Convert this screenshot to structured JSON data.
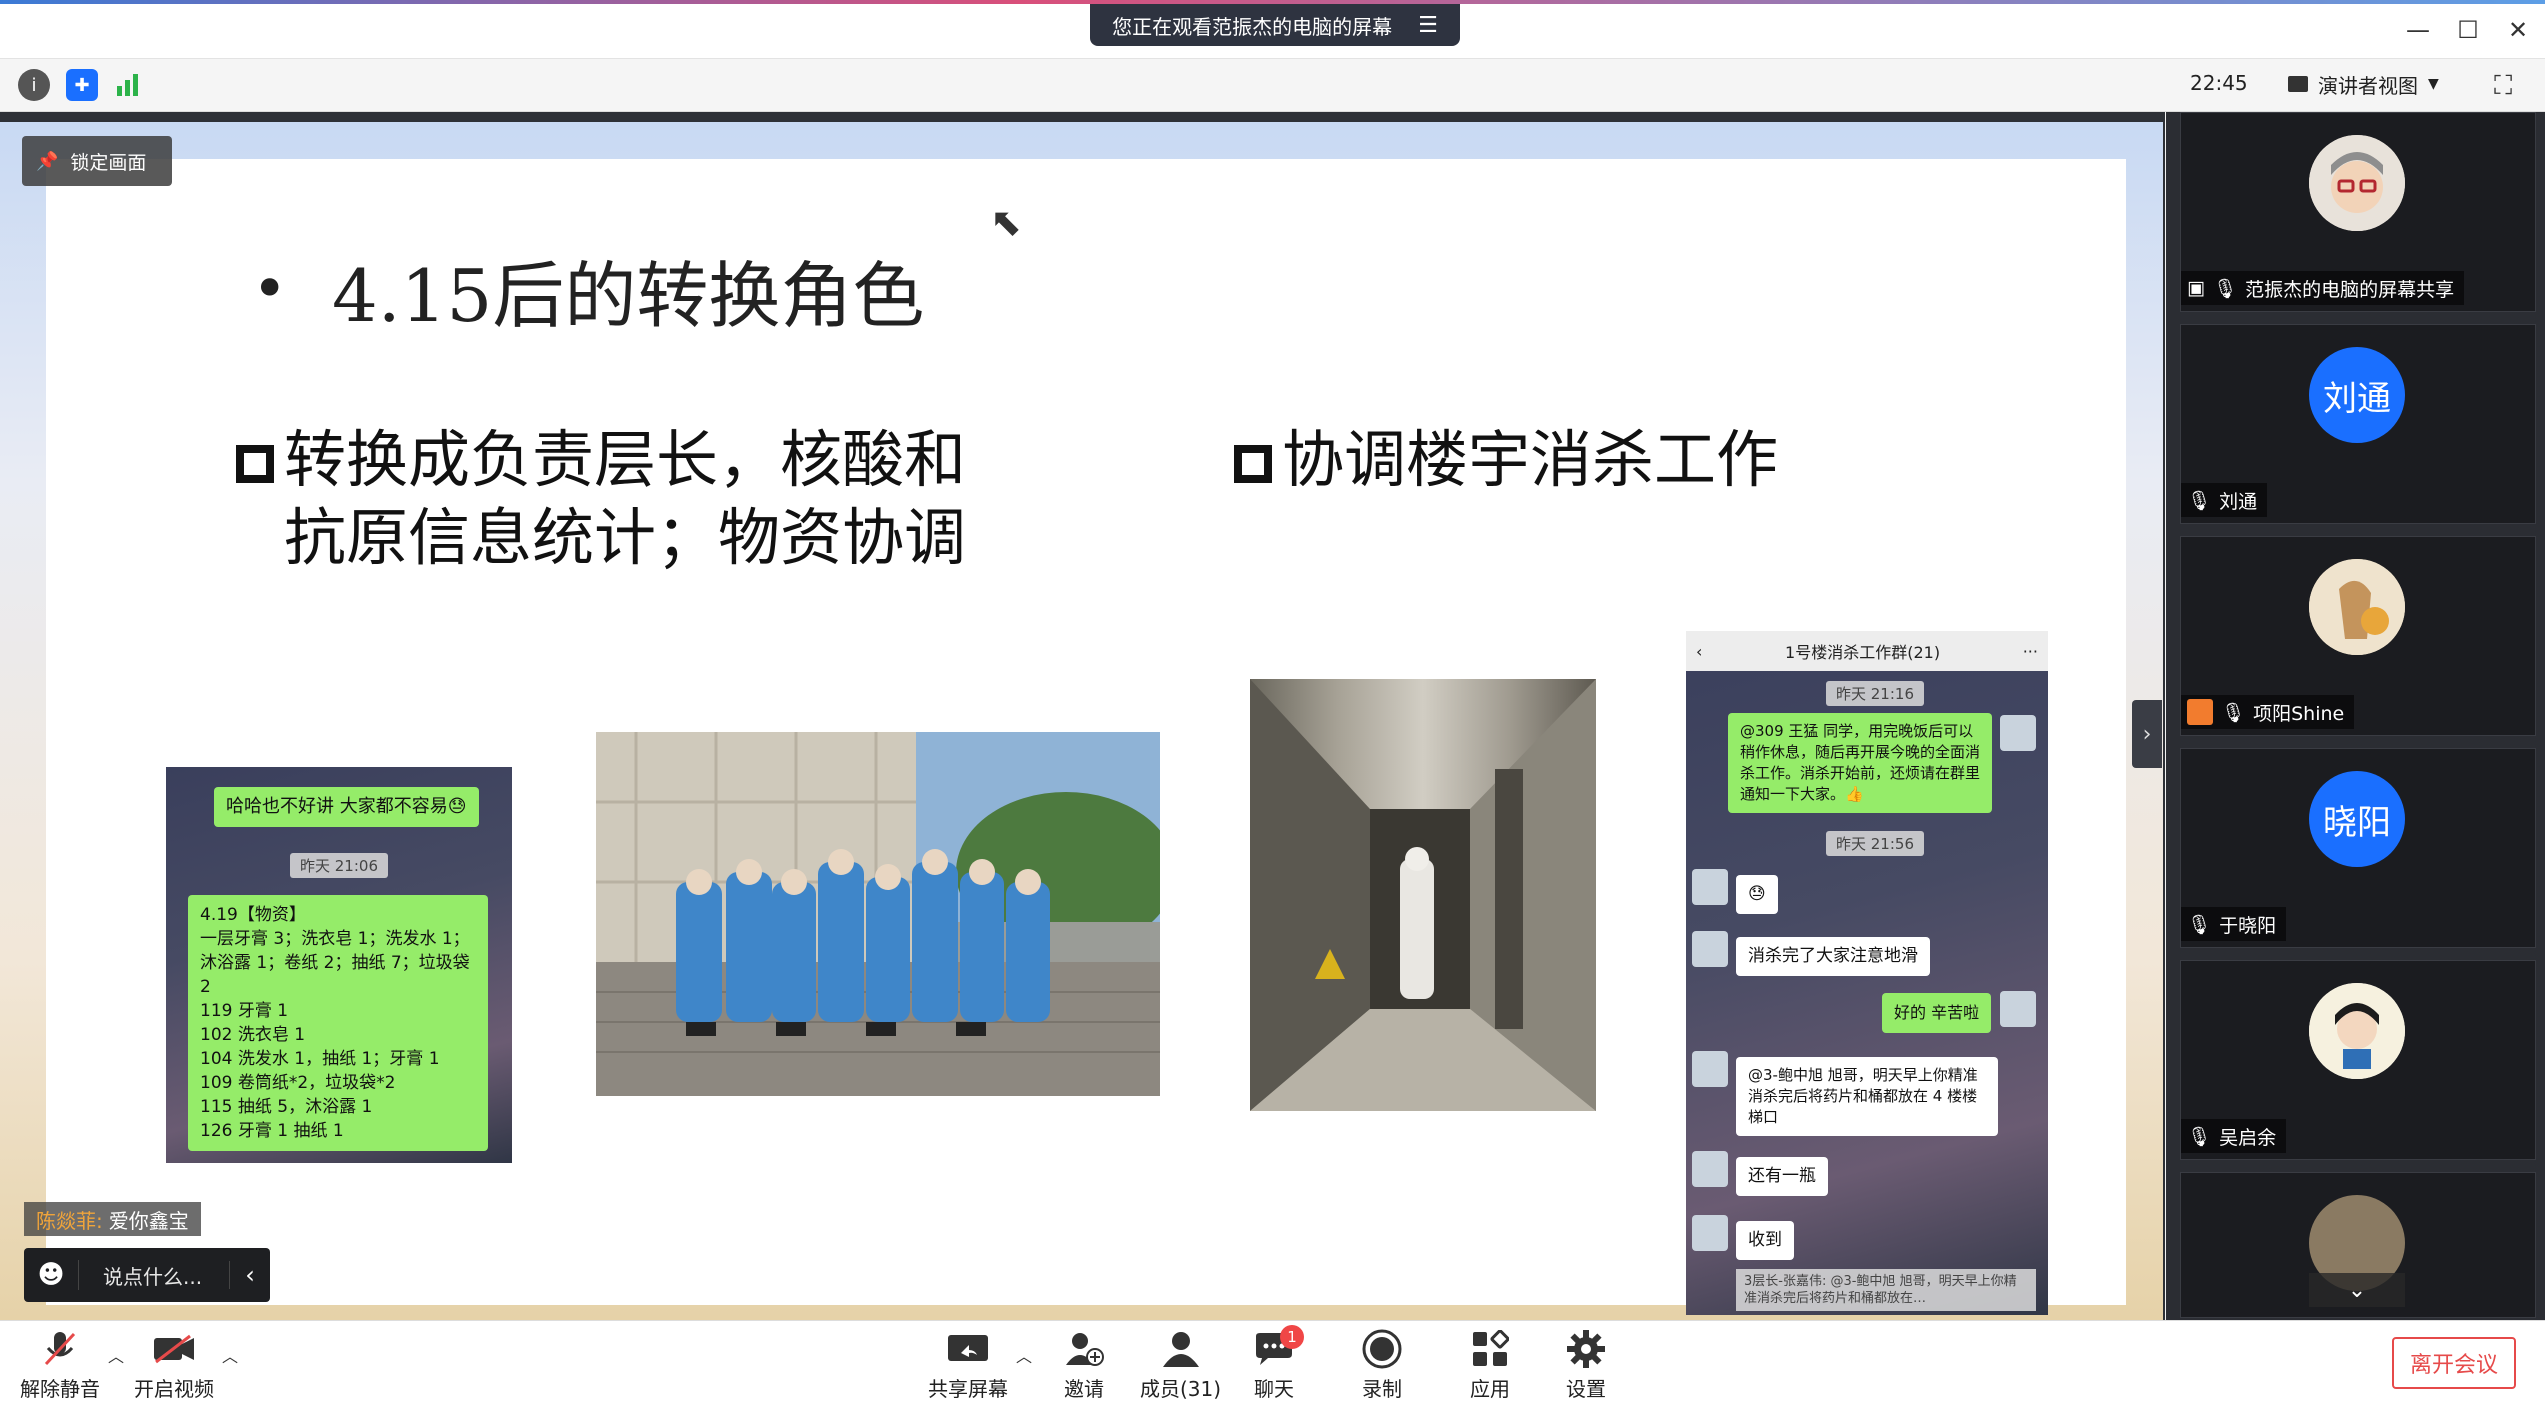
{
  "titlebar": {
    "share_banner": "您正在观看范振杰的电脑的屏幕",
    "minimize": "—",
    "maximize": "☐",
    "close": "✕"
  },
  "toolbar": {
    "clock": "22:45",
    "presenter_view": "演讲者视图"
  },
  "stage": {
    "lock_label": "锁定画面",
    "slide": {
      "title_bullet": "•",
      "title": "4.15后的转换角色",
      "left_point_line1": "转换成负责层长，核酸和",
      "left_point_line2": "抗原信息统计；物资协调",
      "right_point": "协调楼宇消杀工作",
      "chat1": {
        "bubble_top": "哈哈也不好讲 大家都不容易😓",
        "timestamp": "昨天 21:06",
        "lines": [
          "4.19【物资】",
          "一层牙膏 3；洗衣皂 1；洗发水 1；",
          "沐浴露 1；卷纸 2；抽纸 7；垃圾袋",
          "2",
          "119 牙膏 1",
          "102 洗衣皂 1",
          "104 洗发水 1，抽纸 1；牙膏 1",
          "109 卷筒纸*2，垃圾袋*2",
          "115 抽纸 5，沐浴露 1",
          "126 牙膏 1 抽纸 1"
        ]
      },
      "chat2": {
        "back": "‹",
        "title": "1号楼消杀工作群(21)",
        "more": "···",
        "ts1": "昨天 21:16",
        "msg1": "@309 王猛 同学，用完晚饭后可以稍作休息，随后再开展今晚的全面消杀工作。消杀开始前，还烦请在群里通知一下大家。👍",
        "ts2": "昨天 21:56",
        "msg2": "😓",
        "msg3": "消杀完了大家注意地滑",
        "msg4": "好的 辛苦啦",
        "msg5": "@3-鲍中旭 旭哥，明天早上你精准消杀完后将药片和桶都放在 4 楼楼梯口",
        "msg6": "还有一瓶",
        "msg7": "收到",
        "msg8": "3层长-张嘉伟: @3-鲍中旭 旭哥，明天早上你精准消杀完后将药片和桶都放在…"
      }
    },
    "chat_overlay": {
      "sender": "陈燚菲:",
      "message": "爱你鑫宝",
      "input_placeholder": "说点什么...",
      "collapse": "‹"
    }
  },
  "participants": [
    {
      "name": "范振杰的电脑的屏幕共享",
      "avatar_text": "",
      "avatar_color": "#e8e2da"
    },
    {
      "name": "刘通",
      "avatar_text": "刘通",
      "avatar_color": "#1a6fff"
    },
    {
      "name": "项阳Shine",
      "avatar_text": "",
      "avatar_color": "#e9d8b8"
    },
    {
      "name": "于晓阳",
      "avatar_text": "晓阳",
      "avatar_color": "#1a6fff"
    },
    {
      "name": "吴启余",
      "avatar_text": "",
      "avatar_color": "#f1f0ec"
    },
    {
      "name": "",
      "avatar_text": "",
      "avatar_color": "#8a7a62"
    }
  ],
  "sidebar": {
    "collapse": "›",
    "scroll_down": "⌄"
  },
  "bottombar": {
    "mute": "解除静音",
    "video": "开启视频",
    "share": "共享屏幕",
    "invite": "邀请",
    "members": "成员(31)",
    "chat": "聊天",
    "chat_badge": "1",
    "record": "录制",
    "apps": "应用",
    "settings": "设置",
    "leave": "离开会议"
  }
}
